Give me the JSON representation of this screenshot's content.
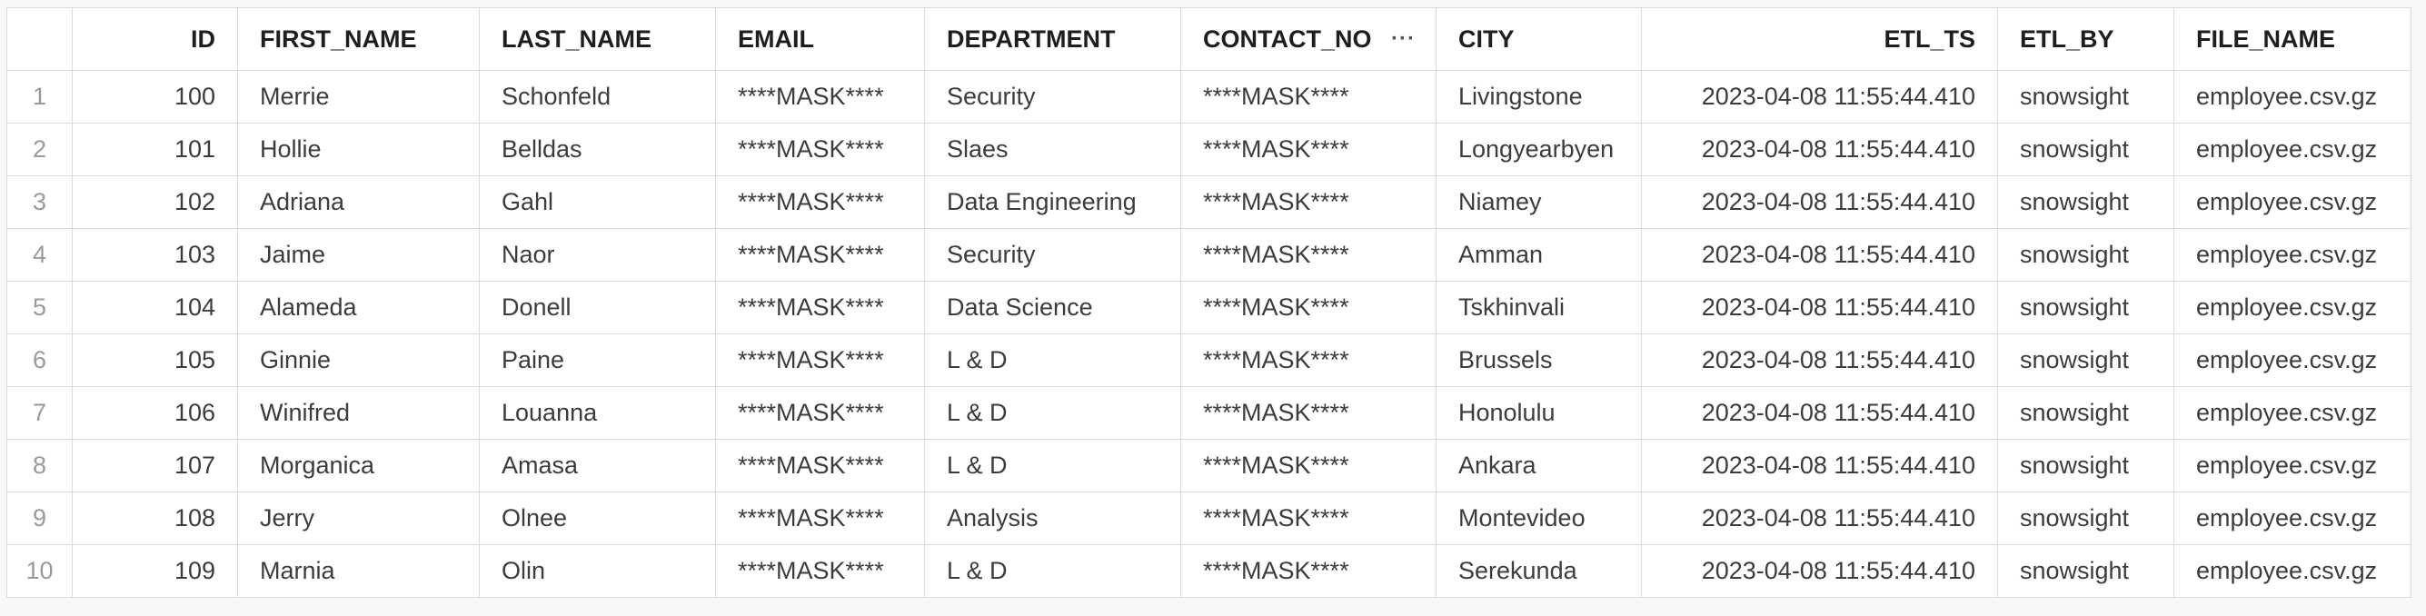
{
  "columns": {
    "id": "ID",
    "first_name": "FIRST_NAME",
    "last_name": "LAST_NAME",
    "email": "EMAIL",
    "department": "DEPARTMENT",
    "contact_no": "CONTACT_NO",
    "city": "CITY",
    "etl_ts": "ETL_TS",
    "etl_by": "ETL_BY",
    "file_name": "FILE_NAME"
  },
  "column_menu_icon": "more-horizontal-icon",
  "rows": [
    {
      "rn": "1",
      "id": "100",
      "first_name": "Merrie",
      "last_name": "Schonfeld",
      "email": "****MASK****",
      "department": "Security",
      "contact_no": "****MASK****",
      "city": "Livingstone",
      "etl_ts": "2023-04-08 11:55:44.410",
      "etl_by": "snowsight",
      "file_name": "employee.csv.gz"
    },
    {
      "rn": "2",
      "id": "101",
      "first_name": "Hollie",
      "last_name": "Belldas",
      "email": "****MASK****",
      "department": "Slaes",
      "contact_no": "****MASK****",
      "city": "Longyearbyen",
      "etl_ts": "2023-04-08 11:55:44.410",
      "etl_by": "snowsight",
      "file_name": "employee.csv.gz"
    },
    {
      "rn": "3",
      "id": "102",
      "first_name": "Adriana",
      "last_name": "Gahl",
      "email": "****MASK****",
      "department": "Data Engineering",
      "contact_no": "****MASK****",
      "city": "Niamey",
      "etl_ts": "2023-04-08 11:55:44.410",
      "etl_by": "snowsight",
      "file_name": "employee.csv.gz"
    },
    {
      "rn": "4",
      "id": "103",
      "first_name": "Jaime",
      "last_name": "Naor",
      "email": "****MASK****",
      "department": "Security",
      "contact_no": "****MASK****",
      "city": "Amman",
      "etl_ts": "2023-04-08 11:55:44.410",
      "etl_by": "snowsight",
      "file_name": "employee.csv.gz"
    },
    {
      "rn": "5",
      "id": "104",
      "first_name": "Alameda",
      "last_name": "Donell",
      "email": "****MASK****",
      "department": "Data Science",
      "contact_no": "****MASK****",
      "city": "Tskhinvali",
      "etl_ts": "2023-04-08 11:55:44.410",
      "etl_by": "snowsight",
      "file_name": "employee.csv.gz"
    },
    {
      "rn": "6",
      "id": "105",
      "first_name": "Ginnie",
      "last_name": "Paine",
      "email": "****MASK****",
      "department": "L & D",
      "contact_no": "****MASK****",
      "city": "Brussels",
      "etl_ts": "2023-04-08 11:55:44.410",
      "etl_by": "snowsight",
      "file_name": "employee.csv.gz"
    },
    {
      "rn": "7",
      "id": "106",
      "first_name": "Winifred",
      "last_name": "Louanna",
      "email": "****MASK****",
      "department": "L & D",
      "contact_no": "****MASK****",
      "city": "Honolulu",
      "etl_ts": "2023-04-08 11:55:44.410",
      "etl_by": "snowsight",
      "file_name": "employee.csv.gz"
    },
    {
      "rn": "8",
      "id": "107",
      "first_name": "Morganica",
      "last_name": "Amasa",
      "email": "****MASK****",
      "department": "L & D",
      "contact_no": "****MASK****",
      "city": "Ankara",
      "etl_ts": "2023-04-08 11:55:44.410",
      "etl_by": "snowsight",
      "file_name": "employee.csv.gz"
    },
    {
      "rn": "9",
      "id": "108",
      "first_name": "Jerry",
      "last_name": "Olnee",
      "email": "****MASK****",
      "department": "Analysis",
      "contact_no": "****MASK****",
      "city": "Montevideo",
      "etl_ts": "2023-04-08 11:55:44.410",
      "etl_by": "snowsight",
      "file_name": "employee.csv.gz"
    },
    {
      "rn": "10",
      "id": "109",
      "first_name": "Marnia",
      "last_name": "Olin",
      "email": "****MASK****",
      "department": "L & D",
      "contact_no": "****MASK****",
      "city": "Serekunda",
      "etl_ts": "2023-04-08 11:55:44.410",
      "etl_by": "snowsight",
      "file_name": "employee.csv.gz"
    }
  ]
}
